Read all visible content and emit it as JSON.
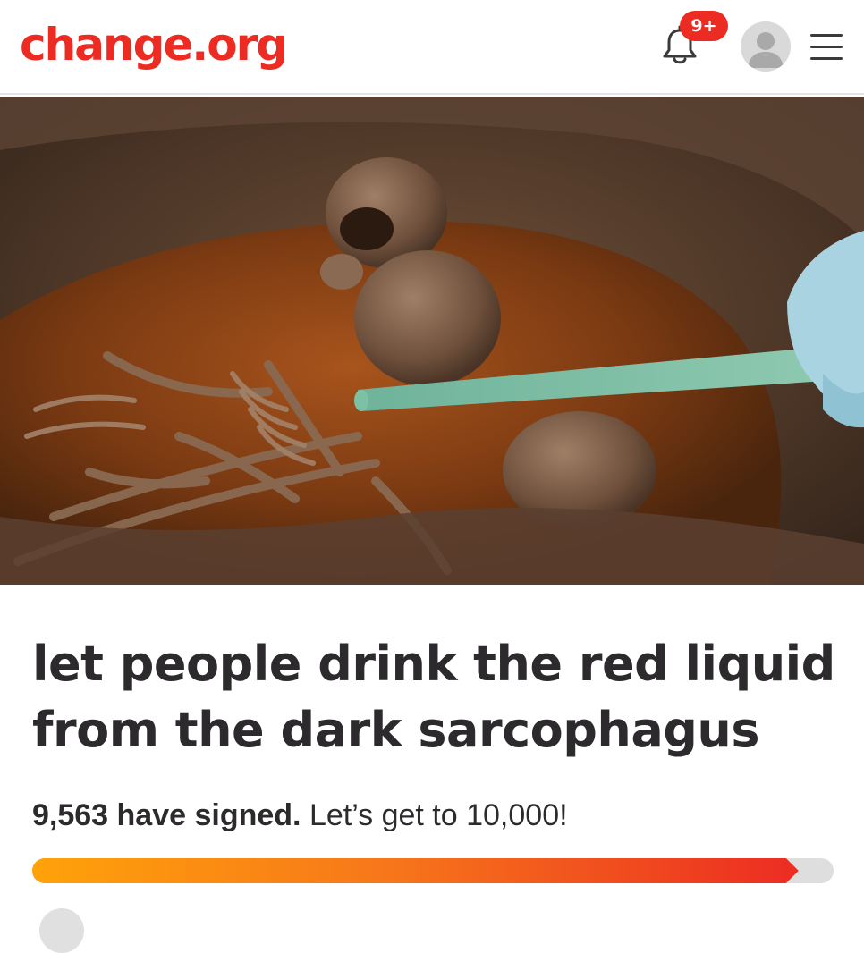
{
  "header": {
    "logo_text": "change.org",
    "logo_color": "#ec2c22",
    "notifications": {
      "icon": "bell-icon",
      "badge_text": "9+"
    },
    "avatar_icon": "user-avatar-icon",
    "menu_icon": "hamburger-menu-icon"
  },
  "hero": {
    "image_description_icon": "hero-photo"
  },
  "petition": {
    "title": "let people drink the red liquid from the dark sarcophagus",
    "signed_bold": "9,563 have signed.",
    "signed_rest": " Let’s get to 10,000!",
    "signatures": 9563,
    "goal": 10000
  },
  "colors": {
    "accent": "#ec2c22",
    "progress_start": "#ffa20a",
    "progress_end": "#ec2c22",
    "text": "#2d2a2e"
  }
}
